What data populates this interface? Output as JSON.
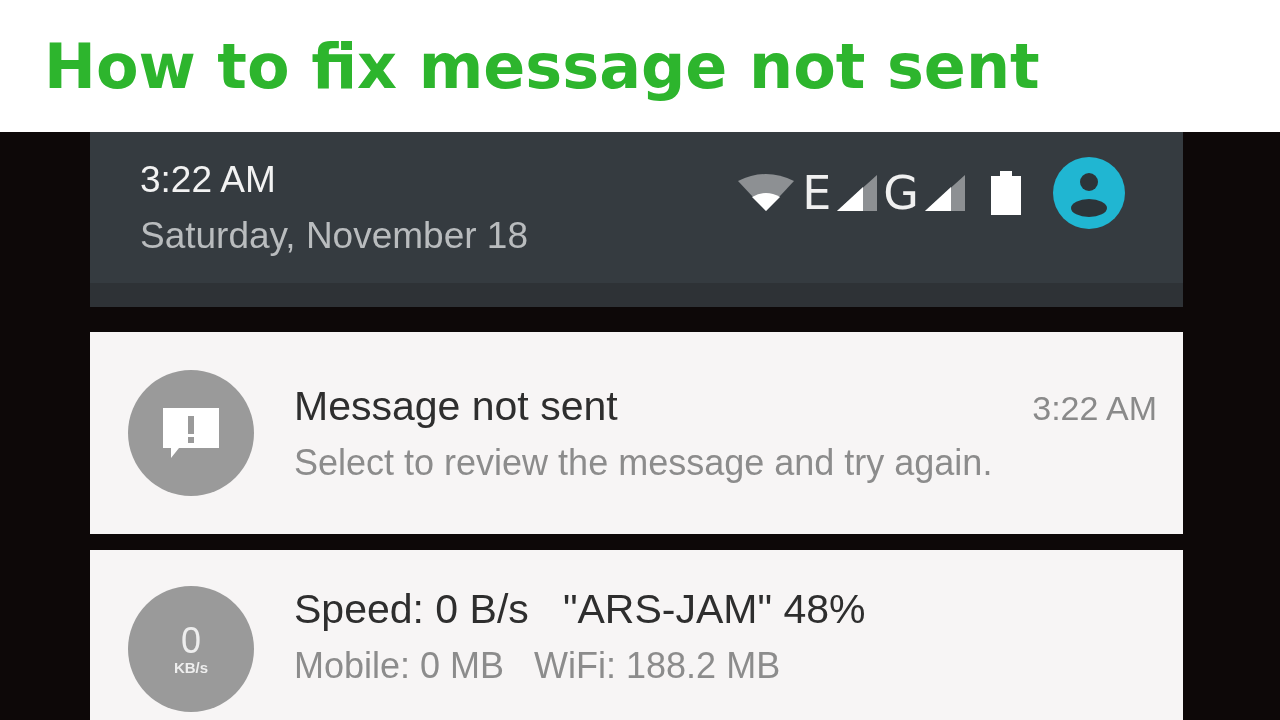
{
  "title": "How to fix message not sent",
  "status": {
    "time": "3:22 AM",
    "date": "Saturday, November 18",
    "network_labels": [
      "E",
      "G"
    ]
  },
  "notifications": [
    {
      "kind": "alert",
      "title": "Message not sent",
      "time": "3:22 AM",
      "text": "Select to review the message and try again."
    },
    {
      "kind": "speed",
      "badge_value": "0",
      "badge_unit": "KB/s",
      "title": "Speed: 0 B/s   \"ARS-JAM\" 48%",
      "text": "Mobile: 0 MB   WiFi: 188.2 MB"
    }
  ]
}
